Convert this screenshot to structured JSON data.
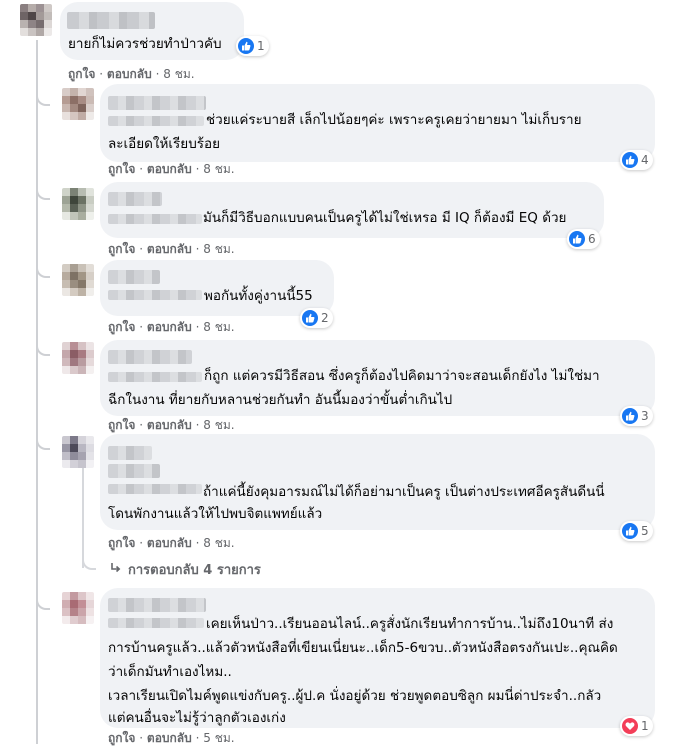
{
  "actions": {
    "like": "ถูกใจ",
    "reply": "ตอบกลับ",
    "sep": "·"
  },
  "comments": [
    {
      "lines": [
        "ยายก็ไม่ควรช่วยทำป่าวคับ"
      ],
      "reaction": "like",
      "count": "1",
      "time": "8 ชม."
    },
    {
      "lines": [
        "ช่วยแค่ระบายสี เล็กไปน้อยๆค่ะ เพราะครูเคยว่ายายมา ไม่เก็บราย",
        "ละเอียดให้เรียบร้อย"
      ],
      "reaction": "like",
      "count": "4",
      "time": "8 ชม."
    },
    {
      "lines": [
        "มันก็มีวิธีบอกแบบคนเป็นครูได้ไม่ใช่เหรอ มี IQ ก็ต้องมี EQ ด้วย"
      ],
      "reaction": "like",
      "count": "6",
      "time": "8 ชม."
    },
    {
      "lines": [
        "พอกันทั้งคู่งานนี้55"
      ],
      "reaction": "like",
      "count": "2",
      "time": "8 ชม."
    },
    {
      "lines": [
        "ก็ถูก แต่ควรมีวิธีสอน ซึ่งครูก็ต้องไปคิดมาว่าจะสอนเด็กยังไง ไม่ใช่มา",
        "ฉีกในงาน ที่ยายกับหลานช่วยกันทำ อันนี้มองว่าขั้นต่ำเกินไป"
      ],
      "reaction": "like",
      "count": "3",
      "time": "8 ชม."
    },
    {
      "lines": [
        "ถ้าแค่นี้ยังคุมอารมณ์ไม่ได้ก็อย่ามาเป็นครู เป็นต่างประเทศอีครูสันดีนนี่",
        "โดนพักงานแล้วให้ไปพบจิตแพทย์แล้ว"
      ],
      "reaction": "like",
      "count": "5",
      "time": "8 ชม."
    },
    {
      "lines": [
        "เคยเห็นป่าว..เรียนออนไลน์..ครูสั่งนักเรียนทำการบ้าน..ไม่ถึง10นาที ส่ง",
        "การบ้านครูแล้ว..แล้วตัวหนังสือที่เขียนเนี่ยนะ..เด็ก5-6ขวบ..ตัวหนังสือตรงกันเปะ..คุณคิด",
        "ว่าเด็กมันทำเองไหม..",
        "เวลาเรียนเปิดไมค์พูดแข่งกับครู..ผู้ป.ค นั่งอยู่ด้วย ช่วยพูดตอบซิลูก ผมนี่ด่าประจำ..กลัว",
        "แต่คนอื่นจะไม่รู้ว่าลูกตัวเองเก่ง"
      ],
      "reaction": "love",
      "count": "1",
      "time": "5 ชม."
    }
  ],
  "more_replies": "การตอบกลับ 4 รายการ",
  "colors": {
    "like_blue": "#1877f2",
    "love_red": "#f33e58",
    "bubble": "#f0f2f5",
    "meta": "#65676b"
  }
}
